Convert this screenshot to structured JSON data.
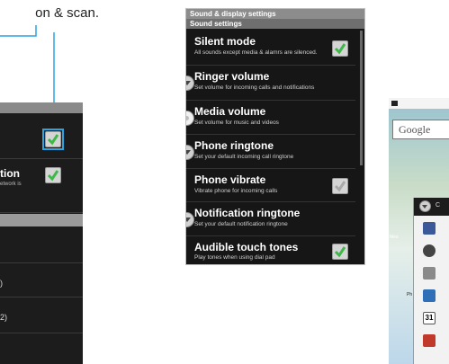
{
  "caption": {
    "text": "on & scan."
  },
  "left_panel": {
    "items": [
      {
        "title": "",
        "sub": ""
      },
      {
        "title": "tion",
        "sub": "etwork is"
      }
    ],
    "values": [
      ")",
      "2)"
    ]
  },
  "settings": {
    "window_title": "Sound & display settings",
    "section": "Sound settings",
    "items": [
      {
        "title": "Silent mode",
        "sub": "All sounds except media & alamrs are silenced.",
        "control": "checkbox-checked"
      },
      {
        "title": "Ringer volume",
        "sub": "Set volume for incoming calls and notifications",
        "control": "dropdown"
      },
      {
        "title": "Media volume",
        "sub": "Set volume for music and videos",
        "control": "dropdown-pressed"
      },
      {
        "title": "Phone ringtone",
        "sub": "Set your default incoming call ringtone",
        "control": "dropdown"
      },
      {
        "title": "Phone vibrate",
        "sub": "Vibrate phone for incoming calls",
        "control": "checkbox-unchecked"
      },
      {
        "title": "Notification ringtone",
        "sub": "Set your default notification ringtone",
        "control": "dropdown"
      },
      {
        "title": "Audible touch tones",
        "sub": "Play tones when using dial pad",
        "control": "checkbox-checked"
      }
    ]
  },
  "right_phone": {
    "search_widget": "Google",
    "labels": {
      "mes": "Mes",
      "ph": "Ph"
    },
    "drawer_label": "C",
    "icons": [
      "facebook-icon",
      "music-icon",
      "camera-icon",
      "gallery-icon",
      "calendar-icon",
      "youtube-icon"
    ]
  },
  "colors": {
    "accent": "#2ba4e0",
    "check": "#3fb84a",
    "panel": "#161616"
  }
}
